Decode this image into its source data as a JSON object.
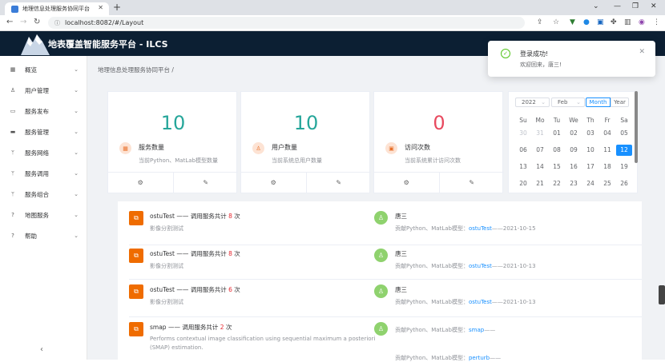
{
  "browser": {
    "tab_title": "地理信息处理服务协同平台",
    "url": "localhost:8082/#/Layout"
  },
  "header": {
    "title": "地表覆盖智能服务平台 - ILCS"
  },
  "breadcrumb": "地理信息处理服务协同平台",
  "breadcrumb_sep": "/",
  "sidebar": {
    "items": [
      {
        "label": "概览",
        "icon": "grid-icon"
      },
      {
        "label": "用户管理",
        "icon": "user-icon"
      },
      {
        "label": "服务发布",
        "icon": "monitor-icon"
      },
      {
        "label": "服务管理",
        "icon": "folder-icon"
      },
      {
        "label": "服务网络",
        "icon": "branch-icon"
      },
      {
        "label": "服务调用",
        "icon": "branch-icon"
      },
      {
        "label": "服务组合",
        "icon": "branch-icon"
      },
      {
        "label": "地图服务",
        "icon": "question-icon"
      },
      {
        "label": "帮助",
        "icon": "question-icon"
      }
    ]
  },
  "stats": [
    {
      "value": "10",
      "label": "服务数量",
      "desc": "当前Python、MatLab模型数量",
      "color": "#26a69a"
    },
    {
      "value": "10",
      "label": "用户数量",
      "desc": "当前系统总用户数量",
      "color": "#26a69a"
    },
    {
      "value": "0",
      "label": "访问次数",
      "desc": "当前系统累计访问次数",
      "color": "#e84a5f"
    }
  ],
  "calendar": {
    "year": "2022",
    "month": "Feb",
    "mode_month": "Month",
    "mode_year": "Year",
    "weekdays": [
      "Su",
      "Mo",
      "Tu",
      "We",
      "Th",
      "Fr",
      "Sa"
    ],
    "days": [
      [
        "30",
        "31",
        "01",
        "02",
        "03",
        "04",
        "05"
      ],
      [
        "06",
        "07",
        "08",
        "09",
        "10",
        "11",
        "12"
      ],
      [
        "13",
        "14",
        "15",
        "16",
        "17",
        "18",
        "19"
      ],
      [
        "20",
        "21",
        "22",
        "23",
        "24",
        "25",
        "26"
      ]
    ],
    "today": "12"
  },
  "feed": [
    {
      "title": "ostuTest —— 调用服务共计",
      "count": "8",
      "unit": "次",
      "sub": "影像分割测试",
      "sub2": "",
      "user": "唐三",
      "contrib": "贡献Python、MatLab模型：",
      "model": "ostuTest",
      "date": "——2021-10-15"
    },
    {
      "title": "ostuTest —— 调用服务共计",
      "count": "8",
      "unit": "次",
      "sub": "影像分割测试",
      "sub2": "",
      "user": "唐三",
      "contrib": "贡献Python、MatLab模型：",
      "model": "ostuTest",
      "date": "——2021-10-13"
    },
    {
      "title": "ostuTest —— 调用服务共计",
      "count": "6",
      "unit": "次",
      "sub": "影像分割测试",
      "sub2": "",
      "user": "唐三",
      "contrib": "贡献Python、MatLab模型：",
      "model": "ostuTest",
      "date": "——2021-10-13"
    },
    {
      "title": "smap —— 调用服务共计",
      "count": "2",
      "unit": "次",
      "sub": "Performs contextual image classification using sequential maximum a posteriori",
      "sub2": "(SMAP) estimation.",
      "user": "",
      "contrib": "贡献Python、MatLab模型：",
      "model": "smap",
      "date": "——"
    },
    {
      "title": "",
      "count": "",
      "unit": "",
      "sub": "",
      "sub2": "",
      "user": "",
      "contrib": "贡献Python、MatLab模型：",
      "model": "perturb",
      "date": "——"
    }
  ],
  "toast": {
    "title": "登录成功!",
    "message": "欢迎回来，唐三!"
  }
}
